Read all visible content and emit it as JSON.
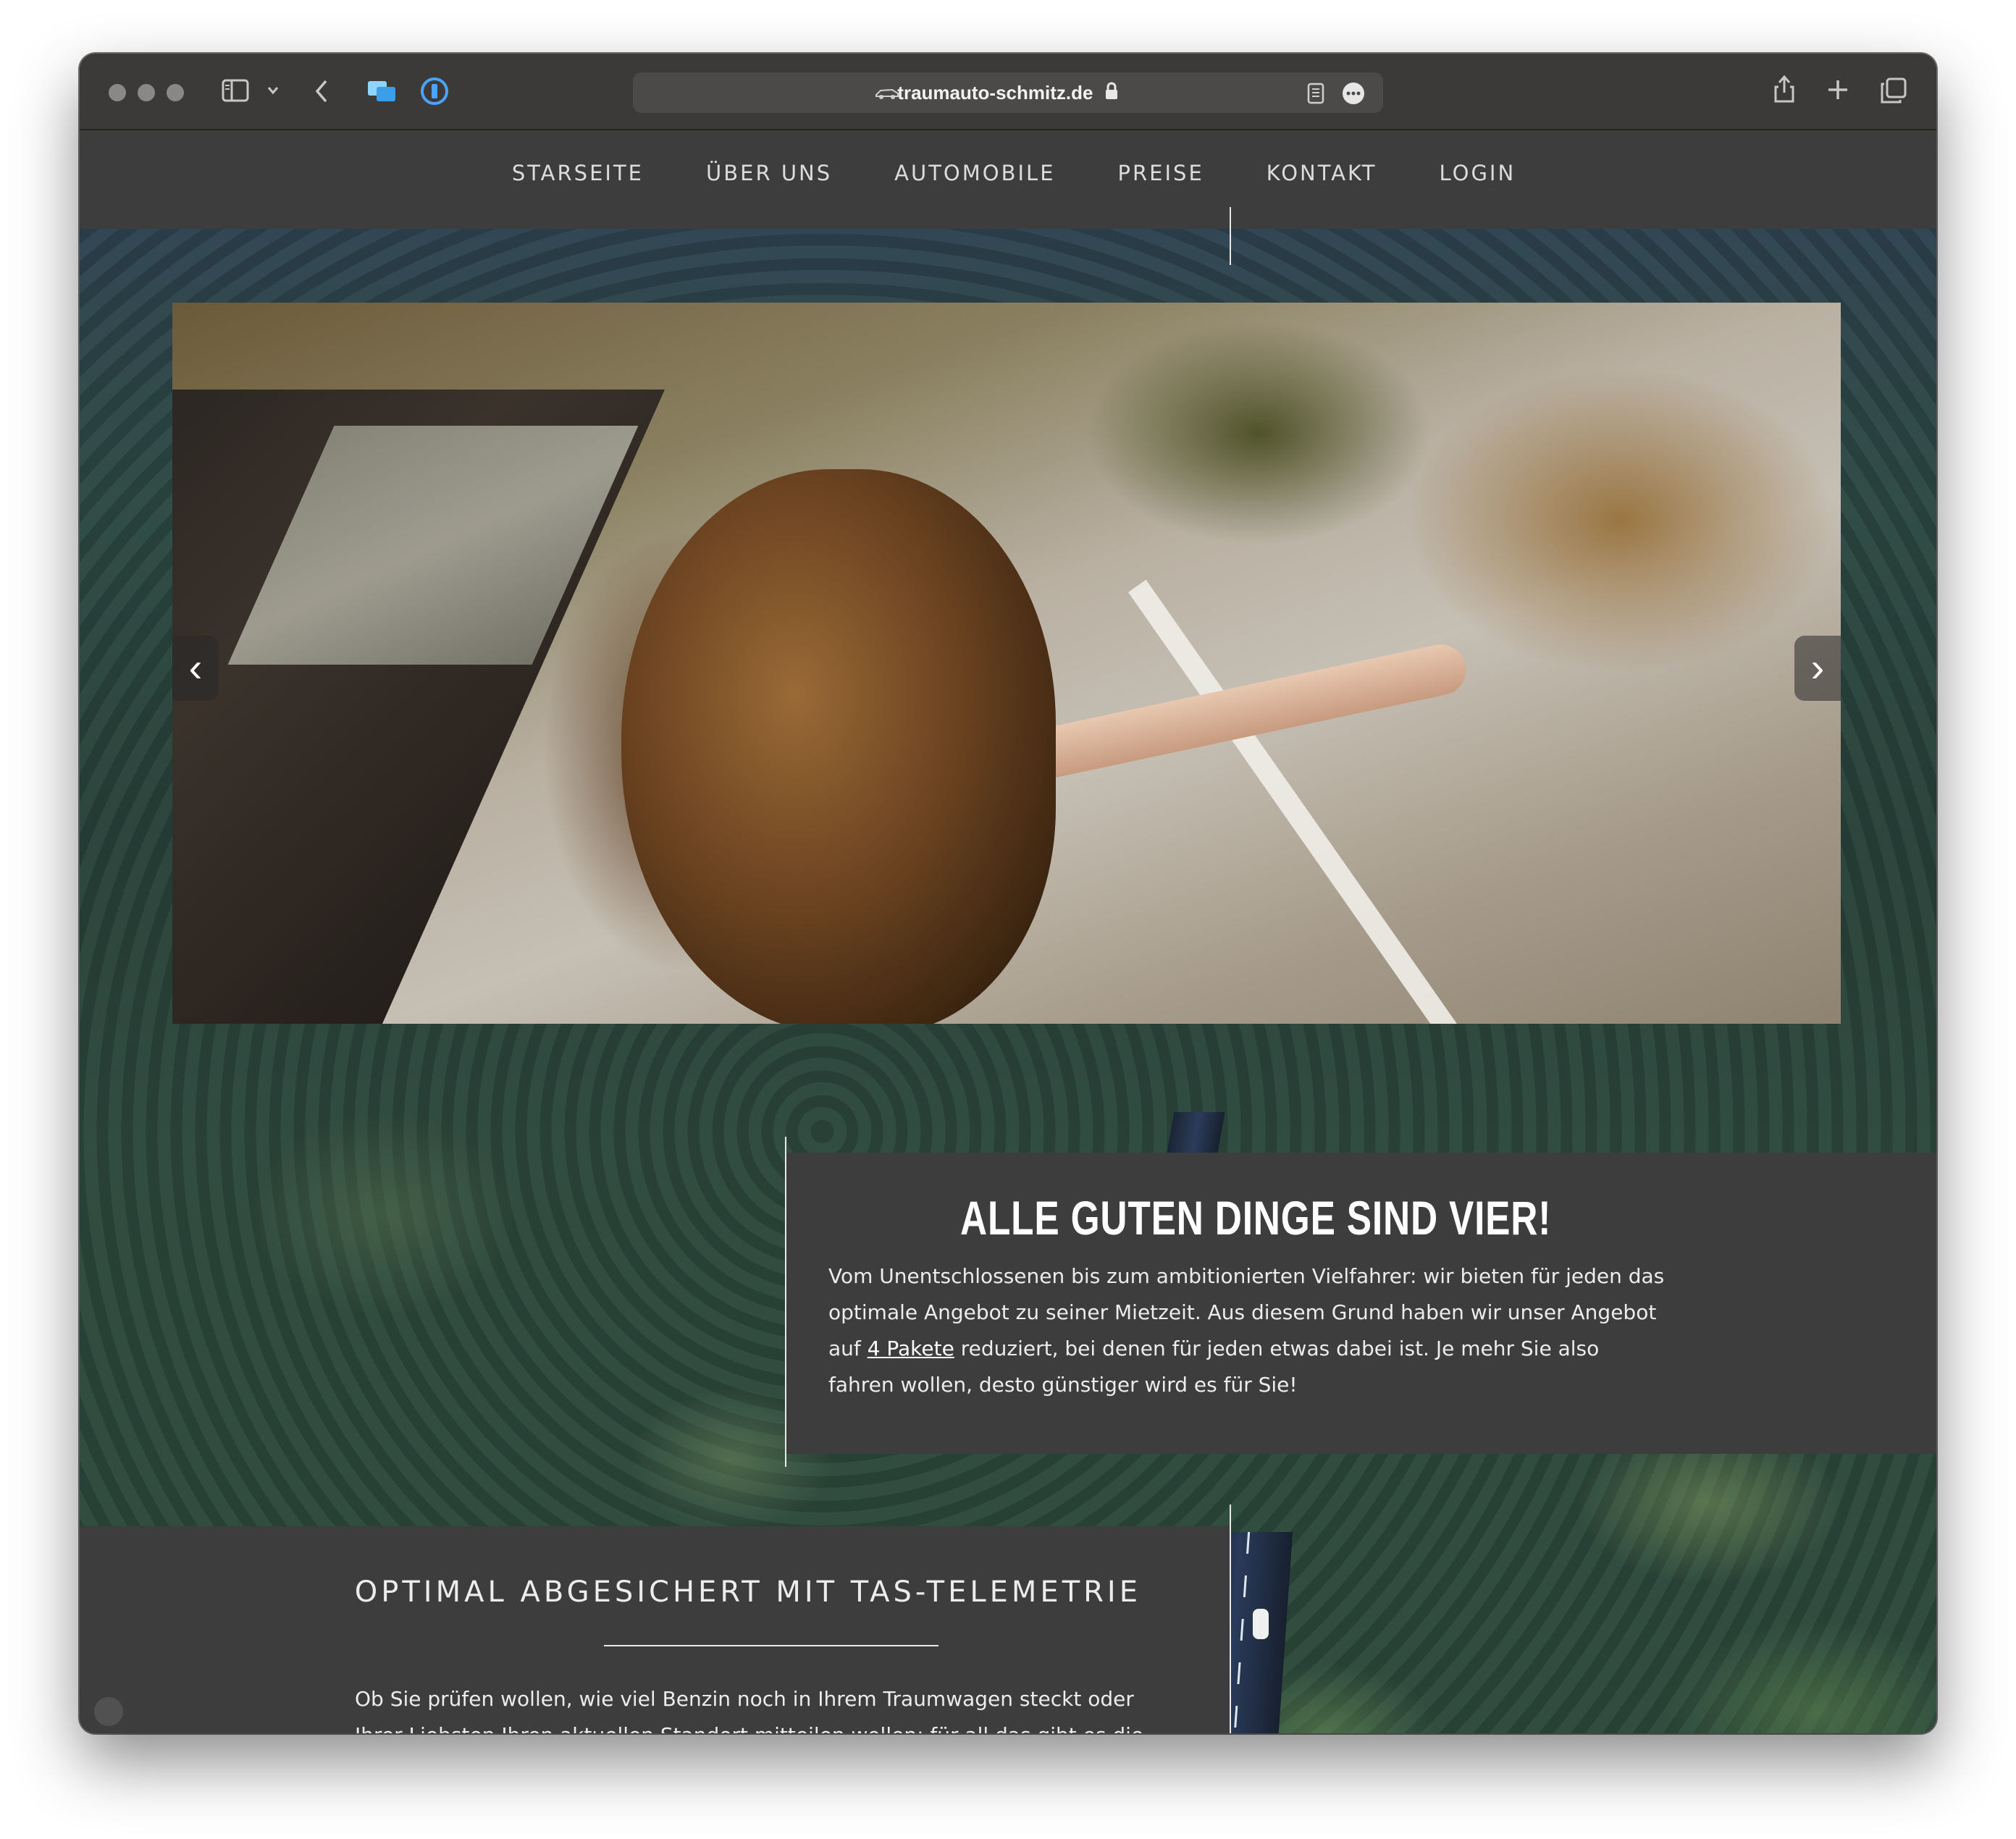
{
  "browser": {
    "url": "traumauto-schmitz.de"
  },
  "nav": {
    "items": [
      "STARSEITE",
      "ÜBER UNS",
      "AUTOMOBILE",
      "PREISE",
      "KONTAKT",
      "LOGIN"
    ]
  },
  "slider": {
    "prev_symbol": "‹",
    "next_symbol": "›"
  },
  "section1": {
    "heading": "ALLE GUTEN DINGE SIND VIER!",
    "text_before_link": "Vom Unentschlossenen bis zum ambitionierten Vielfahrer: wir bieten für jeden das optimale Angebot zu seiner Mietzeit. Aus diesem Grund haben wir unser Angebot auf ",
    "link_text": "4 Pakete",
    "text_after_link": " reduziert, bei denen für jeden etwas dabei ist. Je mehr Sie also fahren wollen, desto günstiger wird es für Sie!"
  },
  "section2": {
    "heading": "OPTIMAL ABGESICHERT MIT TAS-TELEMETRIE",
    "text": "Ob Sie prüfen wollen, wie viel Benzin noch in Ihrem Traumwagen steckt oder Ihrer Liebsten Ihren aktuellen Standort mitteilen wollen: für all das gibt es die TAS-Telemetrie."
  },
  "colors": {
    "page_panel": "#3d3d3d",
    "toolbar": "#3c3a39",
    "url_bar": "#4c4a49",
    "text": "#ececec"
  }
}
